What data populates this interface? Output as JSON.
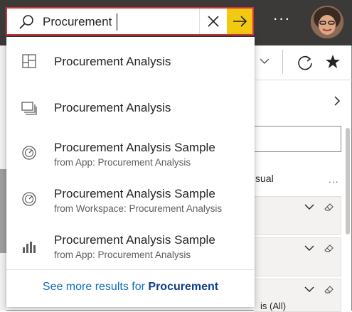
{
  "search": {
    "value": "Procurement",
    "go_label": "→"
  },
  "topbar": {
    "more_label": "···"
  },
  "results": [
    {
      "icon": "dashboard-icon",
      "title": "Procurement Analysis",
      "subtitle": ""
    },
    {
      "icon": "report-icon",
      "title": "Procurement Analysis",
      "subtitle": ""
    },
    {
      "icon": "gauge-icon",
      "title": "Procurement Analysis Sample",
      "subtitle": "from App: Procurement Analysis"
    },
    {
      "icon": "gauge-icon",
      "title": "Procurement Analysis Sample",
      "subtitle": "from Workspace: Procurement Analysis"
    },
    {
      "icon": "bar-chart-icon",
      "title": "Procurement Analysis Sample",
      "subtitle": "from App: Procurement Analysis"
    }
  ],
  "see_more": {
    "prefix": "See more results for ",
    "term": "Procurement"
  },
  "background": {
    "visual_label": "sual",
    "visual_more": "...",
    "filter_text": "is (All)"
  },
  "colors": {
    "topbar": "#3b3a39",
    "search_border": "#d13438",
    "go_button": "#f2c811",
    "link": "#0f6cbd"
  }
}
